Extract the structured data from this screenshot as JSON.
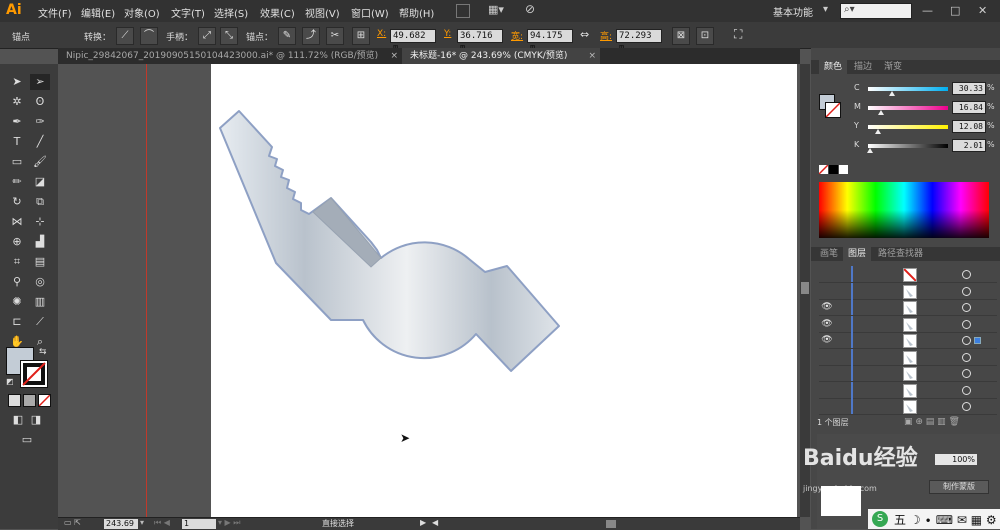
{
  "menubar": {
    "logo": "Ai",
    "menus": [
      "文件(F)",
      "编辑(E)",
      "对象(O)",
      "文字(T)",
      "选择(S)",
      "效果(C)",
      "视图(V)",
      "窗口(W)",
      "帮助(H)"
    ],
    "workspace": "基本功能",
    "window_buttons": [
      "—",
      "□",
      "✕"
    ]
  },
  "control_bar": {
    "anchor_label": "锚点",
    "convert_label": "转换：",
    "handles_label": "手柄：",
    "anchor2_label": "锚点：",
    "x_key": "X:",
    "x_value": "49.682 m",
    "y_key": "Y:",
    "y_value": "36.716 m",
    "w_key": "宽:",
    "w_value": "94.175 m",
    "h_key": "高:",
    "h_value": "72.293 m"
  },
  "tabs": [
    {
      "label": "Nipic_29842067_20190905150104423000.ai* @ 111.72% (RGB/预览)"
    },
    {
      "label": "未标题-16* @ 243.69% (CMYK/预览)"
    }
  ],
  "tab_close": "×",
  "color_panel": {
    "tabs": [
      "颜色",
      "描边",
      "渐变"
    ],
    "channels": [
      {
        "key": "C",
        "value": "30.33",
        "fraction": 0.3033,
        "gradient": "linear-gradient(to right,#fff,#00aeef)"
      },
      {
        "key": "M",
        "value": "16.84",
        "fraction": 0.1684,
        "gradient": "linear-gradient(to right,#fff,#ec008c)"
      },
      {
        "key": "Y",
        "value": "12.08",
        "fraction": 0.1208,
        "gradient": "linear-gradient(to right,#fff,#fff200)"
      },
      {
        "key": "K",
        "value": "2.01",
        "fraction": 0.0201,
        "gradient": "linear-gradient(to right,#fff,#000)"
      }
    ],
    "pct": "%"
  },
  "layers_panel": {
    "tabs": [
      "画笔",
      "图层",
      "路径查找器"
    ],
    "rows": [
      {
        "eye": "",
        "thumb": "red-slash"
      },
      {
        "eye": "",
        "thumb": "shape"
      },
      {
        "eye": "👁",
        "thumb": "shape"
      },
      {
        "eye": "👁",
        "thumb": "shape"
      },
      {
        "eye": "👁",
        "thumb": "shape",
        "selected": true
      },
      {
        "eye": "",
        "thumb": "shape"
      },
      {
        "eye": "",
        "thumb": "shape"
      },
      {
        "eye": "",
        "thumb": "shape"
      },
      {
        "eye": "",
        "thumb": "shape"
      }
    ],
    "footer": "1 个图层"
  },
  "status_bar": {
    "zoom": "243.69",
    "page": "1",
    "tool": "直接选择"
  },
  "nav_zoom": "100%",
  "make_button": "制作蒙版",
  "watermark": "Baidu经验",
  "watermark_sub": "jingyan.baidu.com",
  "colors": {
    "artboard": "#ffffff",
    "shape_stroke": "#8ea0c4",
    "accent": "#ff9a00"
  }
}
